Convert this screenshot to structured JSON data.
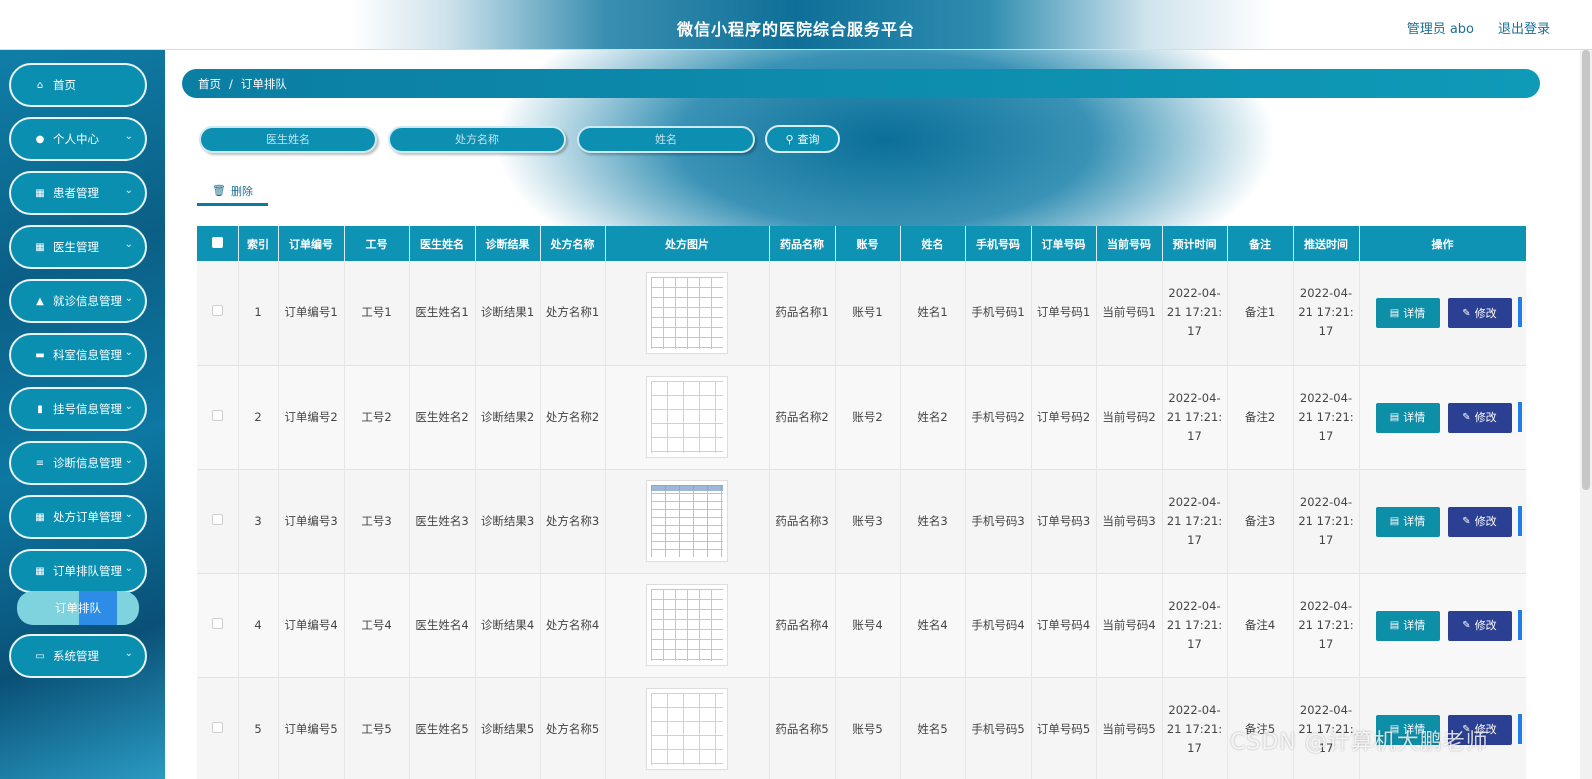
{
  "header": {
    "title": "微信小程序的医院综合服务平台",
    "admin": "管理员 abo",
    "logout": "退出登录"
  },
  "sidebar": {
    "items": [
      {
        "label": "首页",
        "icon": "home-icon"
      },
      {
        "label": "个人中心",
        "icon": "user-icon"
      },
      {
        "label": "患者管理",
        "icon": "grid-icon"
      },
      {
        "label": "医生管理",
        "icon": "grid-icon"
      },
      {
        "label": "就诊信息管理",
        "icon": "thumb-icon"
      },
      {
        "label": "科室信息管理",
        "icon": "monitor-icon"
      },
      {
        "label": "挂号信息管理",
        "icon": "ticket-icon"
      },
      {
        "label": "诊断信息管理",
        "icon": "sliders-icon"
      },
      {
        "label": "处方订单管理",
        "icon": "table-icon"
      },
      {
        "label": "订单排队管理",
        "icon": "grid-icon"
      },
      {
        "label": "系统管理",
        "icon": "briefcase-icon"
      }
    ],
    "active_sub": "订单排队"
  },
  "breadcrumb": {
    "home": "首页",
    "sep": "/",
    "current": "订单排队"
  },
  "search": {
    "doctor_placeholder": "医生姓名",
    "prescription_placeholder": "处方名称",
    "name_placeholder": "姓名",
    "button": "查询"
  },
  "toolbar": {
    "delete": "删除"
  },
  "table": {
    "headers": [
      "索引",
      "订单编号",
      "工号",
      "医生姓名",
      "诊断结果",
      "处方名称",
      "处方图片",
      "药品名称",
      "账号",
      "姓名",
      "手机号码",
      "订单号码",
      "当前号码",
      "预计时间",
      "备注",
      "推送时间",
      "操作"
    ],
    "detail_label": "详情",
    "edit_label": "修改",
    "rows": [
      {
        "index": "1",
        "order_no": "订单编号1",
        "job_no": "工号1",
        "doctor": "医生姓名1",
        "diagnosis": "诊断结果1",
        "prescription": "处方名称1",
        "drug": "药品名称1",
        "account": "账号1",
        "name": "姓名1",
        "phone": "手机号码1",
        "order_num": "订单号码1",
        "current_num": "当前号码1",
        "est_time": "2022-04-21 17:21:17",
        "remark": "备注1",
        "push_time": "2022-04-21 17:21:17"
      },
      {
        "index": "2",
        "order_no": "订单编号2",
        "job_no": "工号2",
        "doctor": "医生姓名2",
        "diagnosis": "诊断结果2",
        "prescription": "处方名称2",
        "drug": "药品名称2",
        "account": "账号2",
        "name": "姓名2",
        "phone": "手机号码2",
        "order_num": "订单号码2",
        "current_num": "当前号码2",
        "est_time": "2022-04-21 17:21:17",
        "remark": "备注2",
        "push_time": "2022-04-21 17:21:17"
      },
      {
        "index": "3",
        "order_no": "订单编号3",
        "job_no": "工号3",
        "doctor": "医生姓名3",
        "diagnosis": "诊断结果3",
        "prescription": "处方名称3",
        "drug": "药品名称3",
        "account": "账号3",
        "name": "姓名3",
        "phone": "手机号码3",
        "order_num": "订单号码3",
        "current_num": "当前号码3",
        "est_time": "2022-04-21 17:21:17",
        "remark": "备注3",
        "push_time": "2022-04-21 17:21:17"
      },
      {
        "index": "4",
        "order_no": "订单编号4",
        "job_no": "工号4",
        "doctor": "医生姓名4",
        "diagnosis": "诊断结果4",
        "prescription": "处方名称4",
        "drug": "药品名称4",
        "account": "账号4",
        "name": "姓名4",
        "phone": "手机号码4",
        "order_num": "订单号码4",
        "current_num": "当前号码4",
        "est_time": "2022-04-21 17:21:17",
        "remark": "备注4",
        "push_time": "2022-04-21 17:21:17"
      },
      {
        "index": "5",
        "order_no": "订单编号5",
        "job_no": "工号5",
        "doctor": "医生姓名5",
        "diagnosis": "诊断结果5",
        "prescription": "处方名称5",
        "drug": "药品名称5",
        "account": "账号5",
        "name": "姓名5",
        "phone": "手机号码5",
        "order_num": "订单号码5",
        "current_num": "当前号码5",
        "est_time": "2022-04-21 17:21:17",
        "remark": "备注5",
        "push_time": "2022-04-21 17:21:17"
      }
    ]
  },
  "watermark": "CSDN @计算机大鹏老师",
  "colors": {
    "primary": "#0e93b4",
    "edit": "#2b3f93",
    "sidebar": "#0b5f86"
  }
}
